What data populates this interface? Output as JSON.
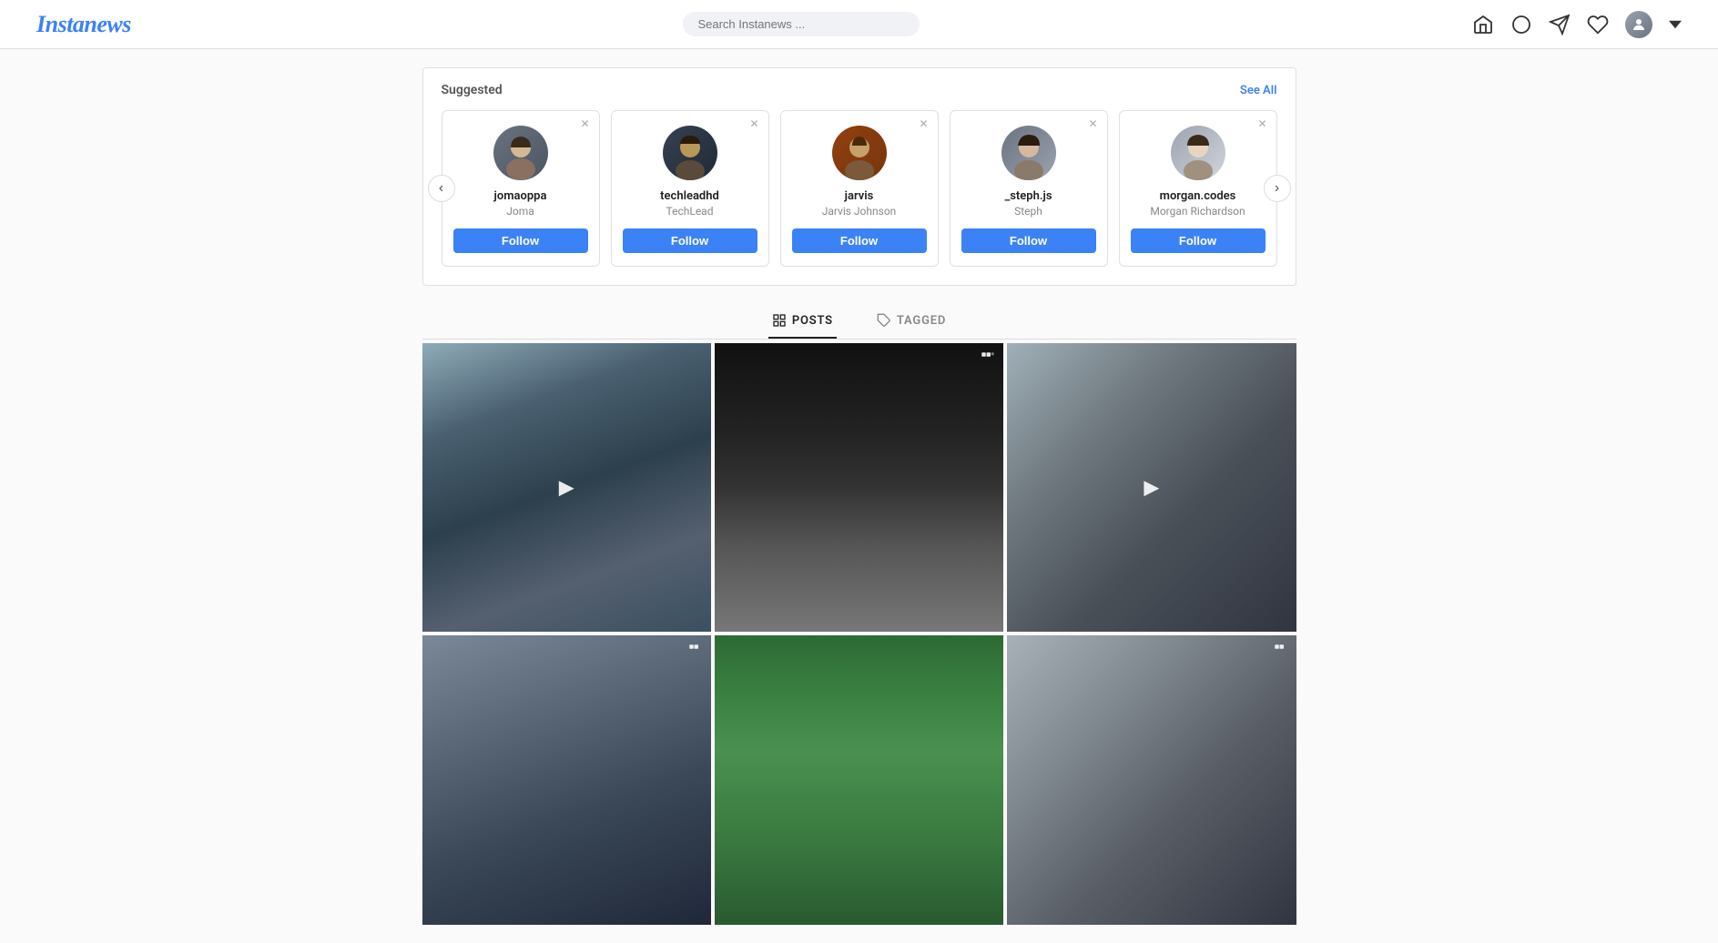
{
  "header": {
    "logo": "Instanews",
    "search": {
      "placeholder": "Search Instanews ..."
    },
    "icons": [
      "home",
      "compass",
      "send",
      "heart",
      "profile"
    ]
  },
  "suggested": {
    "title": "Suggested",
    "see_all": "See All",
    "users": [
      {
        "username": "jomaoppa",
        "display_name": "Joma",
        "follow_label": "Follow",
        "avatar_class": "av-joma"
      },
      {
        "username": "techleadhd",
        "display_name": "TechLead",
        "follow_label": "Follow",
        "avatar_class": "av-techlead"
      },
      {
        "username": "jarvis",
        "display_name": "Jarvis Johnson",
        "follow_label": "Follow",
        "avatar_class": "av-jarvis"
      },
      {
        "username": "_steph.js",
        "display_name": "Steph",
        "follow_label": "Follow",
        "avatar_class": "av-steph"
      },
      {
        "username": "morgan.codes",
        "display_name": "Morgan Richardson",
        "follow_label": "Follow",
        "avatar_class": "av-morgan"
      }
    ]
  },
  "tabs": [
    {
      "label": "POSTS",
      "icon": "grid",
      "active": true
    },
    {
      "label": "TAGGED",
      "icon": "tag",
      "active": false
    }
  ],
  "photos": [
    {
      "type": "video",
      "class": "photo-1"
    },
    {
      "type": "multi",
      "class": "photo-2"
    },
    {
      "type": "video",
      "class": "photo-3"
    },
    {
      "type": "multi",
      "class": "photo-4"
    },
    {
      "type": "normal",
      "class": "photo-5"
    },
    {
      "type": "multi",
      "class": "photo-6"
    }
  ]
}
